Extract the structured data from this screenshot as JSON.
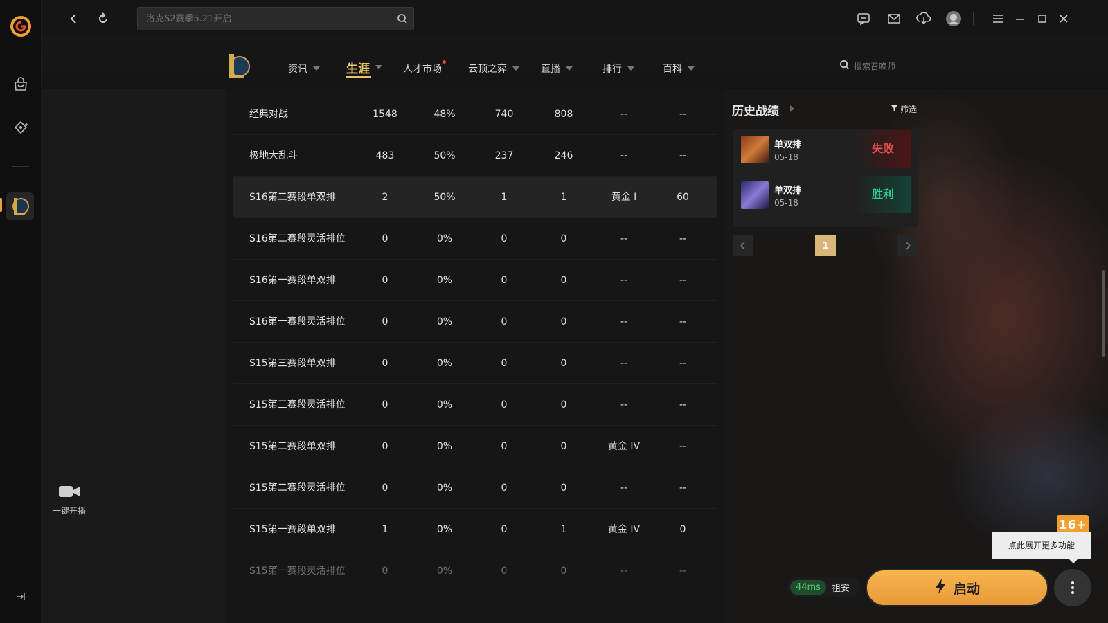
{
  "search": {
    "placeholder": "洛克S2赛季5.21开启"
  },
  "game_nav": [
    {
      "label": "资讯"
    },
    {
      "label": "生涯"
    },
    {
      "label": "人才市场"
    },
    {
      "label": "云顶之弈"
    },
    {
      "label": "直播"
    },
    {
      "label": "排行"
    },
    {
      "label": "百科"
    }
  ],
  "summoner_search": {
    "placeholder": "搜索召唤师"
  },
  "left_tools": {
    "live_label": "一键开播"
  },
  "stats_rows": [
    [
      "经典对战",
      "1548",
      "48%",
      "740",
      "808",
      "--",
      "--"
    ],
    [
      "极地大乱斗",
      "483",
      "50%",
      "237",
      "246",
      "--",
      "--"
    ],
    [
      "S16第二赛段单双排",
      "2",
      "50%",
      "1",
      "1",
      "黄金 I",
      "60"
    ],
    [
      "S16第二赛段灵活排位",
      "0",
      "0%",
      "0",
      "0",
      "--",
      "--"
    ],
    [
      "S16第一赛段单双排",
      "0",
      "0%",
      "0",
      "0",
      "--",
      "--"
    ],
    [
      "S16第一赛段灵活排位",
      "0",
      "0%",
      "0",
      "0",
      "--",
      "--"
    ],
    [
      "S15第三赛段单双排",
      "0",
      "0%",
      "0",
      "0",
      "--",
      "--"
    ],
    [
      "S15第三赛段灵活排位",
      "0",
      "0%",
      "0",
      "0",
      "--",
      "--"
    ],
    [
      "S15第二赛段单双排",
      "0",
      "0%",
      "0",
      "0",
      "黄金 IV",
      "--"
    ],
    [
      "S15第二赛段灵活排位",
      "0",
      "0%",
      "0",
      "0",
      "--",
      "--"
    ],
    [
      "S15第一赛段单双排",
      "1",
      "0%",
      "0",
      "1",
      "黄金 IV",
      "0"
    ],
    [
      "S15第一赛段灵活排位",
      "0",
      "0%",
      "0",
      "0",
      "--",
      "--"
    ]
  ],
  "history": {
    "title": "历史战绩",
    "filter_label": "筛选",
    "matches": [
      {
        "mode": "单双排",
        "date": "05-18",
        "result": "失败"
      },
      {
        "mode": "单双排",
        "date": "05-18",
        "result": "胜利"
      }
    ],
    "page": "1"
  },
  "launch": {
    "ping": "44ms",
    "server": "祖安",
    "button_label": "启动",
    "tooltip": "点此展开更多功能",
    "badge": "16+"
  },
  "colors": {
    "accent": "#e9c46a",
    "launch": "#f3a945",
    "win": "#2fd1a4",
    "lose": "#e35050"
  }
}
